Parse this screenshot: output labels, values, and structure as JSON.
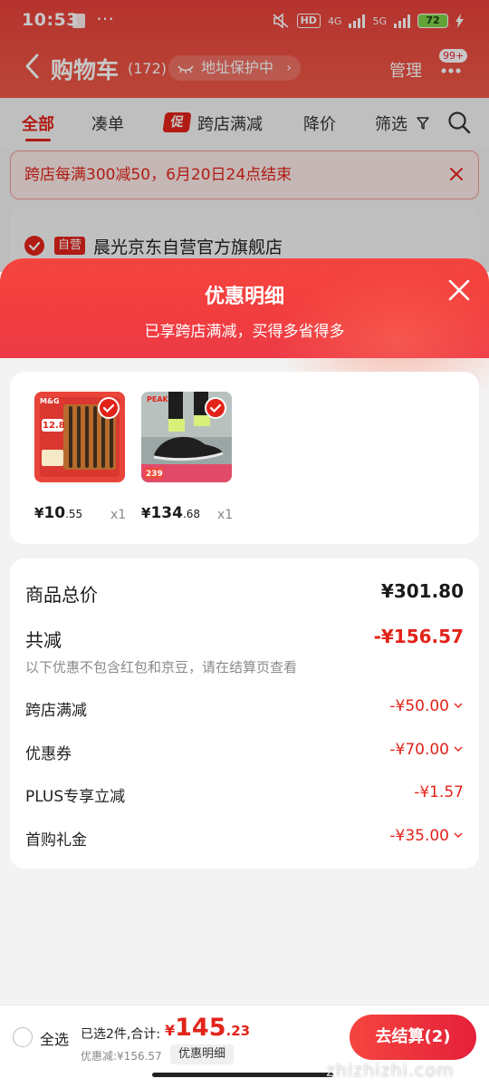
{
  "colors": {
    "accent": "#e2231a",
    "header_red": "#f5453f",
    "sheet_bg": "#f3f3f3"
  },
  "status_bar": {
    "time": "10:53",
    "network": [
      "4G",
      "5G"
    ],
    "hd_label": "HD",
    "battery": "72",
    "icons": [
      "app-notification-icon",
      "more-icon",
      "mute-icon",
      "hd-icon",
      "signal-icon",
      "battery-icon",
      "charging-icon"
    ]
  },
  "nav": {
    "title": "购物车",
    "count": "(172)",
    "address_protect": "地址保护中",
    "manage": "管理",
    "message_badge": "99+"
  },
  "filters": {
    "all": "全部",
    "bundle": "凑单",
    "promo_badge": "促",
    "cross_store": "跨店满减",
    "price_drop": "降价",
    "filter": "筛选"
  },
  "promo_banner": {
    "text": "跨店每满300减50，6月20日24点结束"
  },
  "store": {
    "tag": "自营",
    "name": "晨光京东自营官方旗舰店"
  },
  "sheet": {
    "title": "优惠明细",
    "subtitle": "已享跨店满减，买得多省得多",
    "products": [
      {
        "name_icon": "pen-set-image",
        "price_currency": "¥",
        "price_int": "10",
        "price_dec": ".55",
        "qty": "x1",
        "brand": "M&G",
        "promo_value": "12.8"
      },
      {
        "name_icon": "running-shoe-image",
        "price_currency": "¥",
        "price_int": "134",
        "price_dec": ".68",
        "qty": "x1",
        "brand": "PEAK",
        "promo_value": "239"
      }
    ],
    "summary": {
      "total_label": "商品总价",
      "total_value": "¥301.80",
      "less_label": "共减",
      "less_value": "-¥156.57",
      "note": "以下优惠不包含红包和京豆，请在结算页查看",
      "items": [
        {
          "label": "跨店满减",
          "value": "-¥50.00",
          "expandable": true
        },
        {
          "label": "优惠券",
          "value": "-¥70.00",
          "expandable": true
        },
        {
          "label": "PLUS专享立减",
          "value": "-¥1.57",
          "expandable": false
        },
        {
          "label": "首购礼金",
          "value": "-¥35.00",
          "expandable": true
        }
      ]
    }
  },
  "bottom_bar": {
    "select_all": "全选",
    "selected_info": "已选2件,合计:",
    "total_currency": "¥",
    "total_int": "145",
    "total_dec": ".23",
    "saved": "优惠减:¥156.57",
    "detail_button": "优惠明细",
    "checkout_button": "去结算(2)"
  },
  "watermark": "zhizhizhi.com"
}
